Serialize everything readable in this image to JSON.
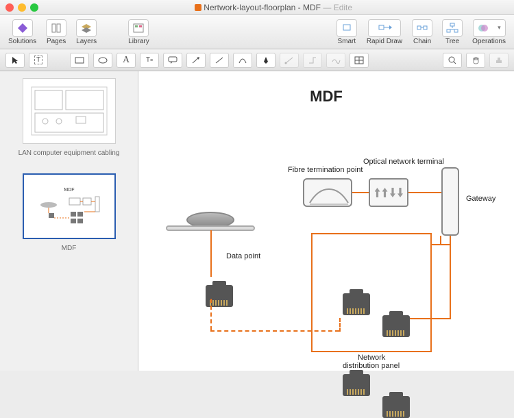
{
  "window": {
    "file": "Nertwork-layout-floorplan",
    "page": "MDF",
    "state": "Edite"
  },
  "toolbar": {
    "solutions": "Solutions",
    "pages": "Pages",
    "layers": "Layers",
    "library": "Library",
    "smart": "Smart",
    "rapid": "Rapid Draw",
    "chain": "Chain",
    "tree": "Tree",
    "operations": "Operations"
  },
  "sidebar": {
    "thumbs": [
      {
        "label": "LAN computer equipment cabling",
        "selected": false
      },
      {
        "label": "MDF",
        "selected": true
      }
    ]
  },
  "canvas": {
    "title": "MDF",
    "labels": {
      "data_point": "Data point",
      "ftp": "Fibre termination point",
      "ont": "Optical network terminal",
      "gateway": "Gateway",
      "ndp1": "Network",
      "ndp2": "distribution panel"
    }
  },
  "diagram_data": {
    "nodes": [
      {
        "id": "wall_plate",
        "label": "",
        "type": "wall-data-outlet"
      },
      {
        "id": "data_point",
        "label": "Data point",
        "type": "rj45-port"
      },
      {
        "id": "ftp",
        "label": "Fibre termination point",
        "type": "fibre-termination"
      },
      {
        "id": "ont",
        "label": "Optical network terminal",
        "type": "optical-terminal"
      },
      {
        "id": "gateway",
        "label": "Gateway",
        "type": "gateway"
      },
      {
        "id": "ndp",
        "label": "Network distribution panel",
        "type": "patch-panel",
        "ports": 4
      }
    ],
    "edges": [
      {
        "from": "wall_plate",
        "to": "data_point",
        "style": "solid",
        "color": "orange"
      },
      {
        "from": "data_point",
        "to": "ndp",
        "style": "dashed",
        "color": "orange"
      },
      {
        "from": "ftp",
        "to": "ont",
        "style": "solid",
        "color": "orange"
      },
      {
        "from": "ont",
        "to": "gateway",
        "style": "solid",
        "color": "orange"
      },
      {
        "from": "gateway",
        "to": "ndp",
        "style": "solid",
        "color": "orange"
      },
      {
        "from": "ndp",
        "to": "gateway",
        "style": "solid",
        "color": "orange"
      }
    ]
  }
}
